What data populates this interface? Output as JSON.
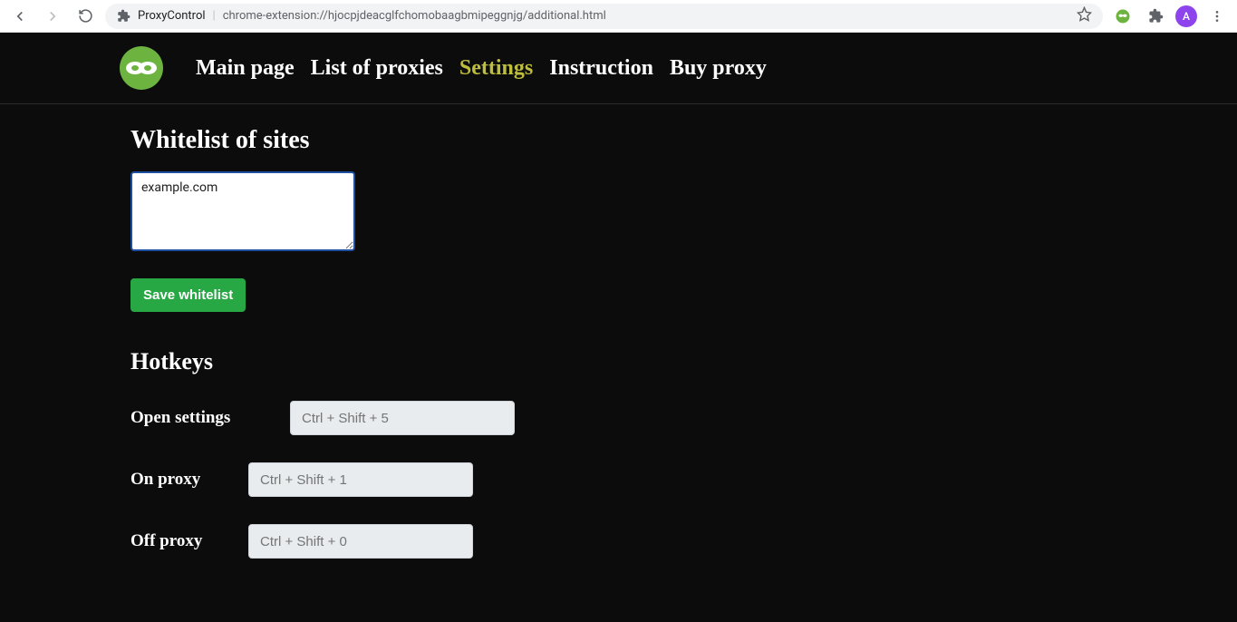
{
  "browser": {
    "ext_name": "ProxyControl",
    "url": "chrome-extension://hjocpjdeacglfchomobaagbmipeggnjg/additional.html",
    "avatar_letter": "A"
  },
  "nav": {
    "items": [
      {
        "label": "Main page",
        "active": false
      },
      {
        "label": "List of proxies",
        "active": false
      },
      {
        "label": "Settings",
        "active": true
      },
      {
        "label": "Instruction",
        "active": false
      },
      {
        "label": "Buy proxy",
        "active": false
      }
    ]
  },
  "whitelist": {
    "title": "Whitelist of sites",
    "value": "example.com",
    "save_label": "Save whitelist"
  },
  "hotkeys": {
    "title": "Hotkeys",
    "rows": [
      {
        "label": "Open settings",
        "placeholder": "Ctrl + Shift + 5",
        "label_width": 176
      },
      {
        "label": "On proxy",
        "placeholder": "Ctrl + Shift + 1",
        "label_width": 130
      },
      {
        "label": "Off proxy",
        "placeholder": "Ctrl + Shift + 0",
        "label_width": 130
      }
    ]
  }
}
